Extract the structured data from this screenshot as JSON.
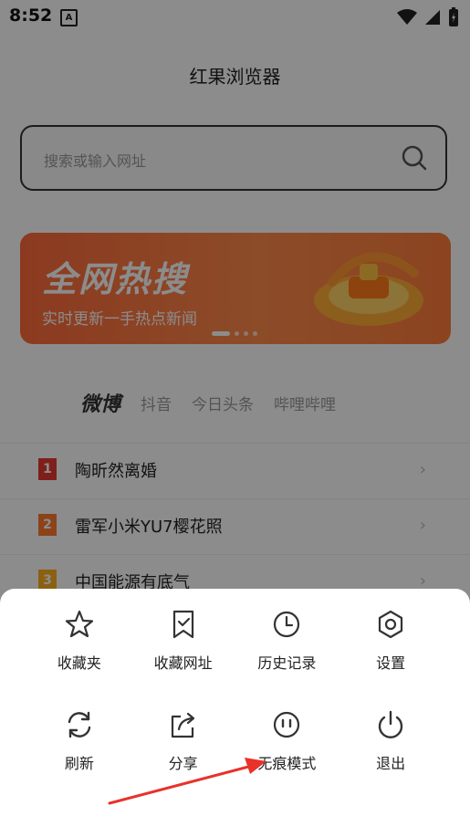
{
  "status": {
    "time": "8:52",
    "a_icon": "A"
  },
  "app": {
    "title": "红果浏览器"
  },
  "search": {
    "placeholder": "搜索或输入网址"
  },
  "banner": {
    "title": "全网热搜",
    "subtitle": "实时更新一手热点新闻"
  },
  "tabs": [
    {
      "label": "微博"
    },
    {
      "label": "抖音"
    },
    {
      "label": "今日头条"
    },
    {
      "label": "哔哩哔哩"
    }
  ],
  "hot_list": [
    {
      "rank": "1",
      "text": "陶昕然离婚"
    },
    {
      "rank": "2",
      "text": "雷军小米YU7樱花照"
    },
    {
      "rank": "3",
      "text": "中国能源有底气"
    }
  ],
  "menu": [
    {
      "label": "收藏夹",
      "icon": "star-icon"
    },
    {
      "label": "收藏网址",
      "icon": "bookmark-icon"
    },
    {
      "label": "历史记录",
      "icon": "clock-icon"
    },
    {
      "label": "设置",
      "icon": "settings-icon"
    },
    {
      "label": "刷新",
      "icon": "refresh-icon"
    },
    {
      "label": "分享",
      "icon": "share-icon"
    },
    {
      "label": "无痕模式",
      "icon": "incognito-icon"
    },
    {
      "label": "退出",
      "icon": "power-icon"
    }
  ],
  "colors": {
    "accent": "#ff6a3a",
    "arrow": "#e8322a"
  }
}
